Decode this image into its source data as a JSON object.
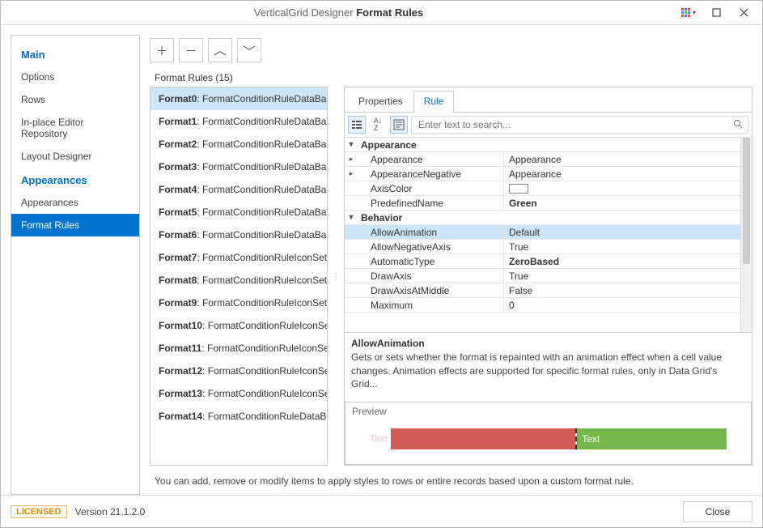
{
  "titlebar": {
    "prefix": "VerticalGrid Designer ",
    "title": "Format Rules"
  },
  "sidebar": {
    "groups": [
      {
        "header": "Main",
        "items": [
          "Options",
          "Rows",
          "In-place Editor Repository",
          "Layout Designer"
        ]
      },
      {
        "header": "Appearances",
        "items": [
          "Appearances",
          "Format Rules"
        ]
      }
    ],
    "selected": "Format Rules"
  },
  "toolbar": {
    "add_tip": "Add",
    "remove_tip": "Remove",
    "up_tip": "Move Up",
    "down_tip": "Move Down"
  },
  "list": {
    "header": "Format Rules (15)",
    "selected_index": 0,
    "items": [
      {
        "name": "Format0",
        "type": "FormatConditionRuleDataBar"
      },
      {
        "name": "Format1",
        "type": "FormatConditionRuleDataBar"
      },
      {
        "name": "Format2",
        "type": "FormatConditionRuleDataBar"
      },
      {
        "name": "Format3",
        "type": "FormatConditionRuleDataBar"
      },
      {
        "name": "Format4",
        "type": "FormatConditionRuleDataBar"
      },
      {
        "name": "Format5",
        "type": "FormatConditionRuleDataBar"
      },
      {
        "name": "Format6",
        "type": "FormatConditionRuleDataBar"
      },
      {
        "name": "Format7",
        "type": "FormatConditionRuleIconSet"
      },
      {
        "name": "Format8",
        "type": "FormatConditionRuleIconSet"
      },
      {
        "name": "Format9",
        "type": "FormatConditionRuleIconSet"
      },
      {
        "name": "Format10",
        "type": "FormatConditionRuleIconSet"
      },
      {
        "name": "Format11",
        "type": "FormatConditionRuleIconSet"
      },
      {
        "name": "Format12",
        "type": "FormatConditionRuleIconSet"
      },
      {
        "name": "Format13",
        "type": "FormatConditionRuleIconSet"
      },
      {
        "name": "Format14",
        "type": "FormatConditionRuleDataBar"
      }
    ]
  },
  "tabs": {
    "items": [
      "Properties",
      "Rule"
    ],
    "active_index": 1
  },
  "search": {
    "placeholder": "Enter text to search..."
  },
  "propgrid": {
    "categories": [
      {
        "label": "Appearance",
        "rows": [
          {
            "name": "Appearance",
            "value": "Appearance",
            "expandable": true
          },
          {
            "name": "AppearanceNegative",
            "value": "Appearance",
            "expandable": true
          },
          {
            "name": "AxisColor",
            "value": "",
            "color_swatch": true
          },
          {
            "name": "PredefinedName",
            "value": "Green",
            "bold": true
          }
        ]
      },
      {
        "label": "Behavior",
        "rows": [
          {
            "name": "AllowAnimation",
            "value": "Default",
            "selected": true
          },
          {
            "name": "AllowNegativeAxis",
            "value": "True"
          },
          {
            "name": "AutomaticType",
            "value": "ZeroBased",
            "bold": true
          },
          {
            "name": "DrawAxis",
            "value": "True"
          },
          {
            "name": "DrawAxisAtMiddle",
            "value": "False"
          },
          {
            "name": "Maximum",
            "value": "0"
          }
        ]
      }
    ],
    "desc": {
      "title": "AllowAnimation",
      "text": "Gets or sets whether the format is repainted with an animation effect when a cell value changes. Animation effects are supported for specific format rules, only in Data Grid's Grid..."
    }
  },
  "preview": {
    "label": "Preview",
    "neg_label": "Text",
    "pos_label": "Text",
    "neg_color": "#d35d56",
    "pos_color": "#75b749"
  },
  "hint": "You can add, remove or modify items to apply styles to rows or entire records based upon a custom format rule.",
  "footer": {
    "licensed": "LICENSED",
    "version": "Version 21.1.2.0",
    "close": "Close"
  }
}
